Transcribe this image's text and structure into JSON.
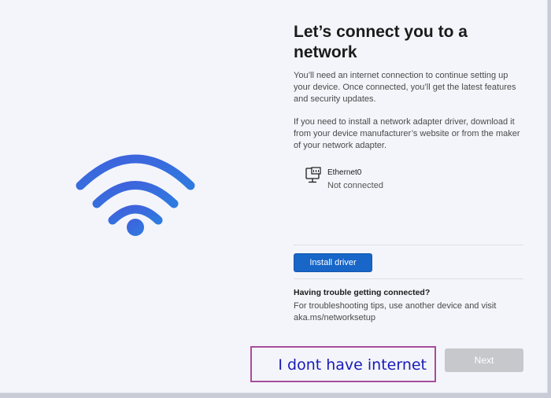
{
  "colors": {
    "accent": "#1766c8",
    "wifi_gradient_start": "#4060dc",
    "wifi_gradient_end": "#2f7ae0",
    "highlight_border": "#a84d9a",
    "link_text": "#1a1ab8",
    "disabled_button": "#c6c8cc"
  },
  "illustration": {
    "icon": "wifi-icon"
  },
  "main": {
    "title": "Let’s connect you to a network",
    "paragraph_1": "You’ll need an internet connection to continue setting up your device. Once connected, you’ll get the latest features and security updates.",
    "paragraph_2": "If you need to install a network adapter driver, download it from your device manufacturer’s website or from the maker of your network adapter."
  },
  "adapters": [
    {
      "icon": "ethernet-monitor-icon",
      "name": "Ethernet0",
      "status": "Not connected"
    }
  ],
  "buttons": {
    "install_driver": "Install driver",
    "no_internet": "I dont have internet",
    "next": "Next"
  },
  "help": {
    "heading": "Having trouble getting connected?",
    "text": "For troubleshooting tips, use another device and visit aka.ms/networksetup"
  }
}
